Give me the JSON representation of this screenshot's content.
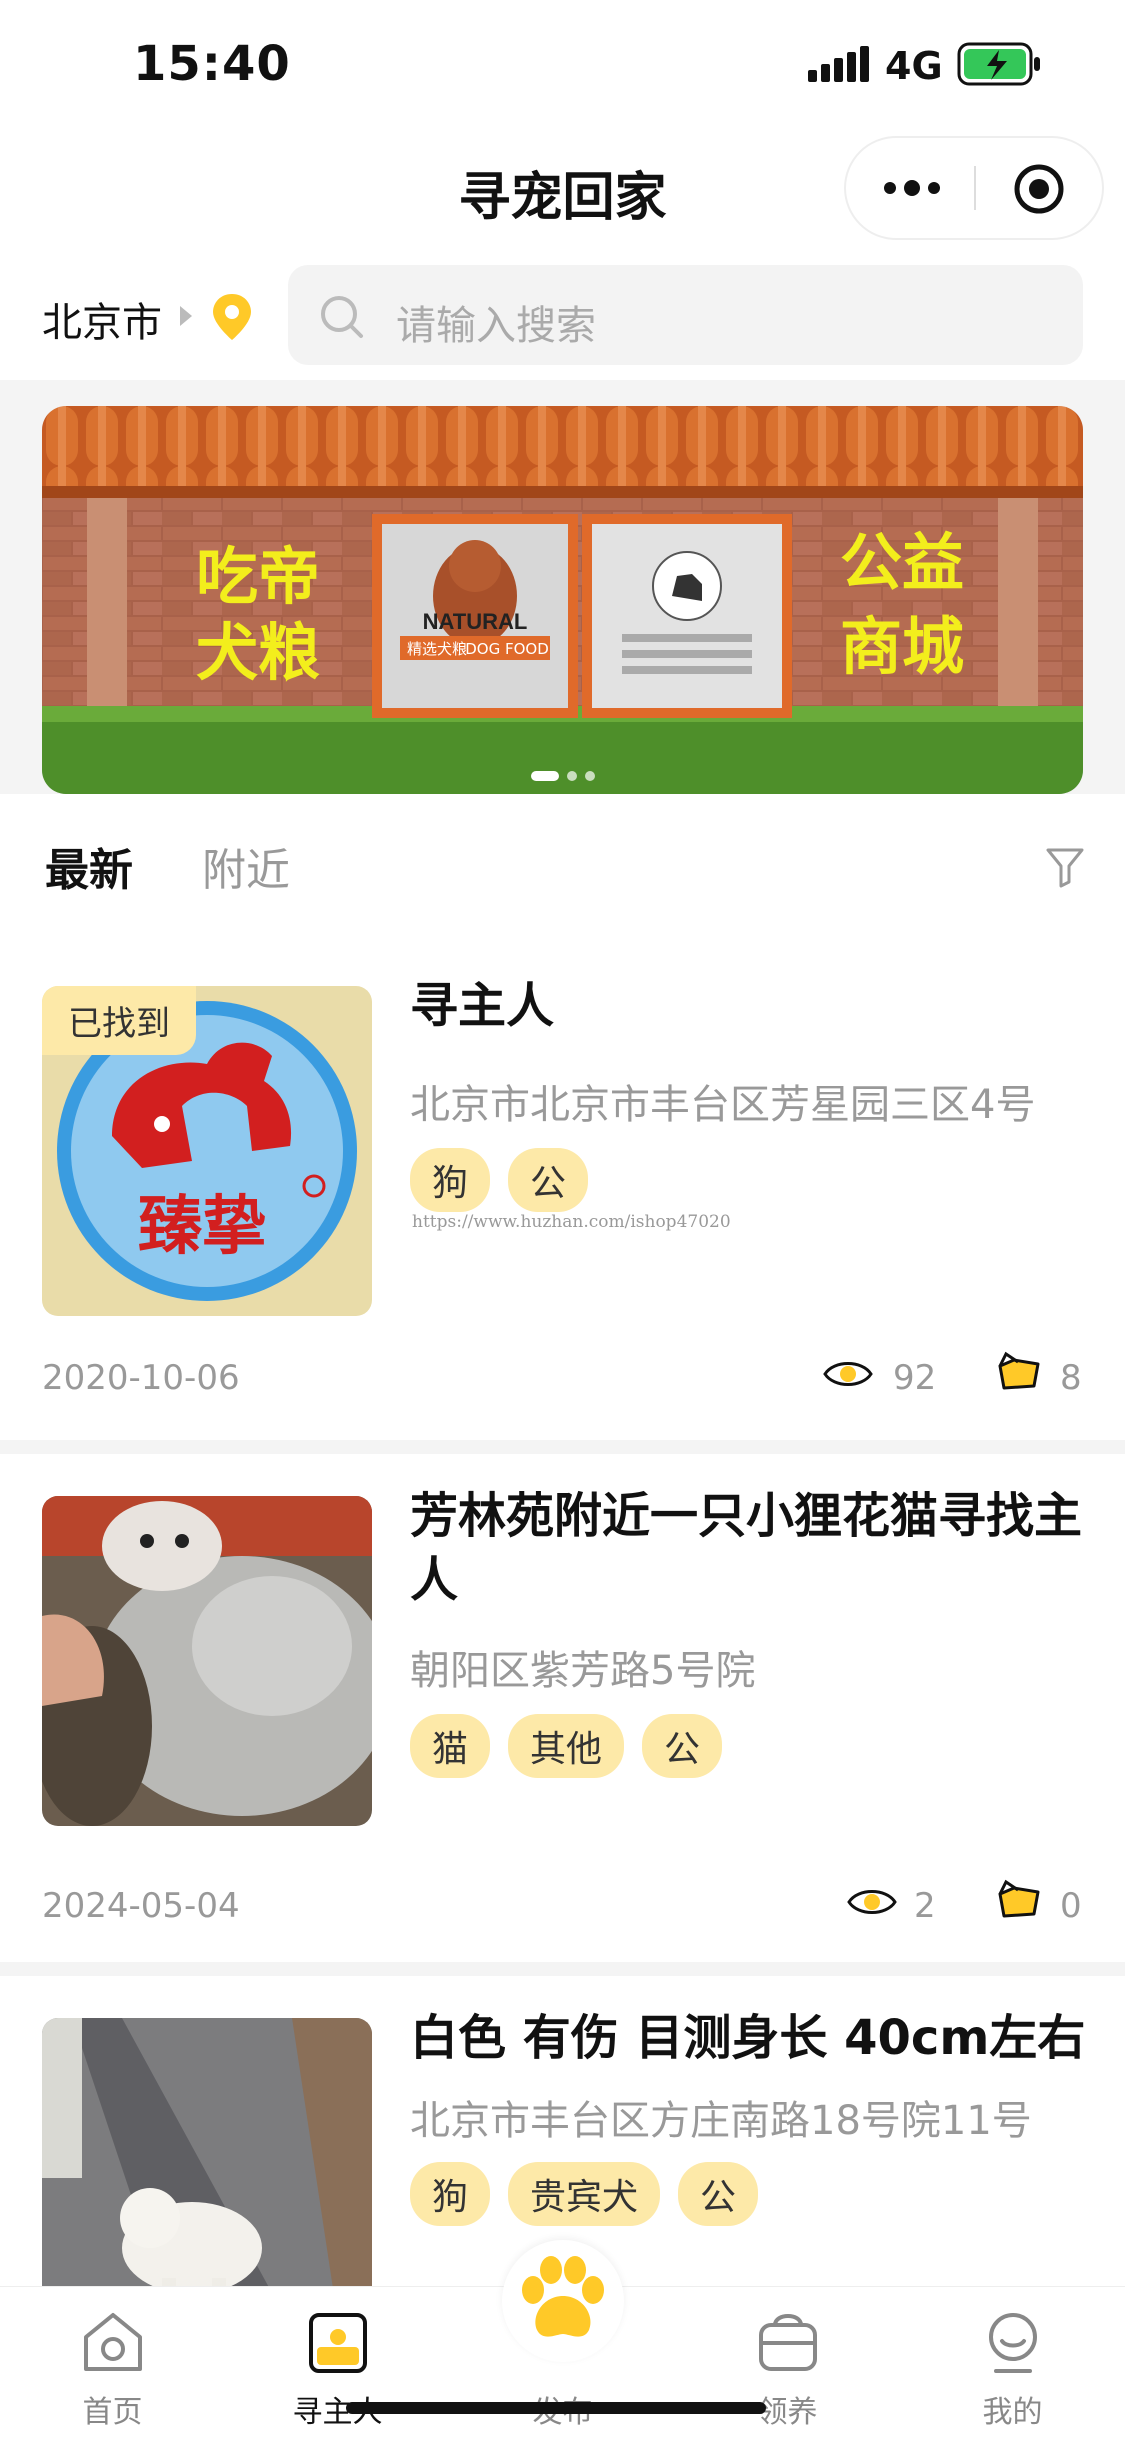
{
  "status_bar": {
    "time": "15:40",
    "network": "4G"
  },
  "nav": {
    "title": "寻宠回家"
  },
  "location": {
    "city": "北京市"
  },
  "search": {
    "placeholder": "请输入搜索"
  },
  "banner": {
    "left_text_1": "吃帝",
    "left_text_2": "犬粮",
    "right_text_1": "公益",
    "right_text_2": "商城",
    "bag_brand": "NATURAL",
    "bag_sub_1": "精选犬粮",
    "bag_sub_2": "DOG FOOD",
    "slide_count": 3,
    "active_slide": 1
  },
  "tabs": {
    "latest": "最新",
    "nearby": "附近"
  },
  "posts": [
    {
      "badge": "已找到",
      "title": "寻主人",
      "address": "北京市北京市丰台区芳星园三区4号",
      "tags": [
        "狗",
        "公"
      ],
      "url": "https://www.huzhan.com/ishop47020",
      "date": "2020-10-06",
      "views": "92",
      "likes": "8",
      "logo_text": "臻挚"
    },
    {
      "title": "芳林苑附近一只小狸花猫寻找主人",
      "address": "朝阳区紫芳路5号院",
      "tags": [
        "猫",
        "其他",
        "公"
      ],
      "date": "2024-05-04",
      "views": "2",
      "likes": "0"
    },
    {
      "title": "白色 有伤 目测身长 40cm左右",
      "address": "北京市丰台区方庄南路18号院11号",
      "tags": [
        "狗",
        "贵宾犬",
        "公"
      ]
    }
  ],
  "tabbar": {
    "home": "首页",
    "find_owner": "寻主人",
    "publish": "发布",
    "adopt": "领养",
    "mine": "我的"
  },
  "colors": {
    "accent": "#ffc928",
    "tag_bg": "#fde9a8"
  }
}
